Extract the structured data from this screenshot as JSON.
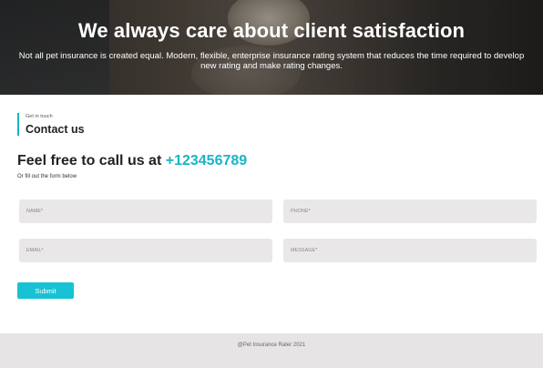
{
  "hero": {
    "title": "We always care about client satisfaction",
    "description": "Not all pet insurance is created equal. Modern, flexible, enterprise insurance rating system that reduces the time required to develop new rating and make rating changes."
  },
  "contact": {
    "eyebrow": "Get in touch",
    "title": "Contact us",
    "call_prefix": "Feel free to call us at ",
    "phone": "+123456789",
    "subtext": "Or fill out the form below",
    "fields": {
      "name_placeholder": "NAME*",
      "phone_placeholder": "PHONE*",
      "email_placeholder": "EMAIL*",
      "message_placeholder": "MESSAGE*"
    },
    "submit_label": "Submit"
  },
  "footer": {
    "copyright": "@Pet Insurance Rater 2021"
  },
  "colors": {
    "accent": "#17b5c7",
    "button": "#17c2d4",
    "field_bg": "#e9e7e8",
    "footer_bg": "#e6e4e5"
  }
}
